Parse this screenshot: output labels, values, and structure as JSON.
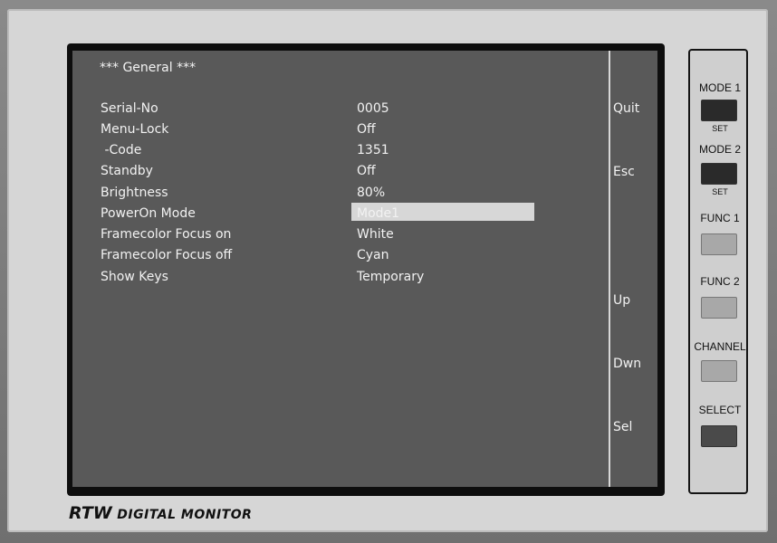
{
  "menu": {
    "title": "*** General ***",
    "rows": [
      {
        "label": "Serial-No",
        "value": "0005"
      },
      {
        "label": "Menu-Lock",
        "value": "Off"
      },
      {
        "label": " -Code",
        "value": "1351"
      },
      {
        "label": "Standby",
        "value": "Off"
      },
      {
        "label": "Brightness",
        "value": "80%"
      },
      {
        "label": "PowerOn Mode",
        "value": "Mode1",
        "selected": true
      },
      {
        "label": "Framecolor Focus on",
        "value": "White"
      },
      {
        "label": "Framecolor Focus off",
        "value": "Cyan"
      },
      {
        "label": "Show Keys",
        "value": "Temporary"
      }
    ]
  },
  "softkeys": [
    "Quit",
    "Esc",
    "Up",
    "Dwn",
    "Sel"
  ],
  "branding": {
    "rtw": "RTW",
    "digital_monitor": "DIGITAL MONITOR"
  },
  "buttons": [
    {
      "label": "MODE 1",
      "sub": "SET"
    },
    {
      "label": "MODE 2",
      "sub": "SET"
    },
    {
      "label": "FUNC 1"
    },
    {
      "label": "FUNC 2"
    },
    {
      "label": "CHANNEL"
    },
    {
      "label": "SELECT"
    }
  ],
  "colors": {
    "screen_bg": "#595959",
    "selection_bg": "#d7d7d7",
    "panel_bg": "#d6d6d6"
  }
}
